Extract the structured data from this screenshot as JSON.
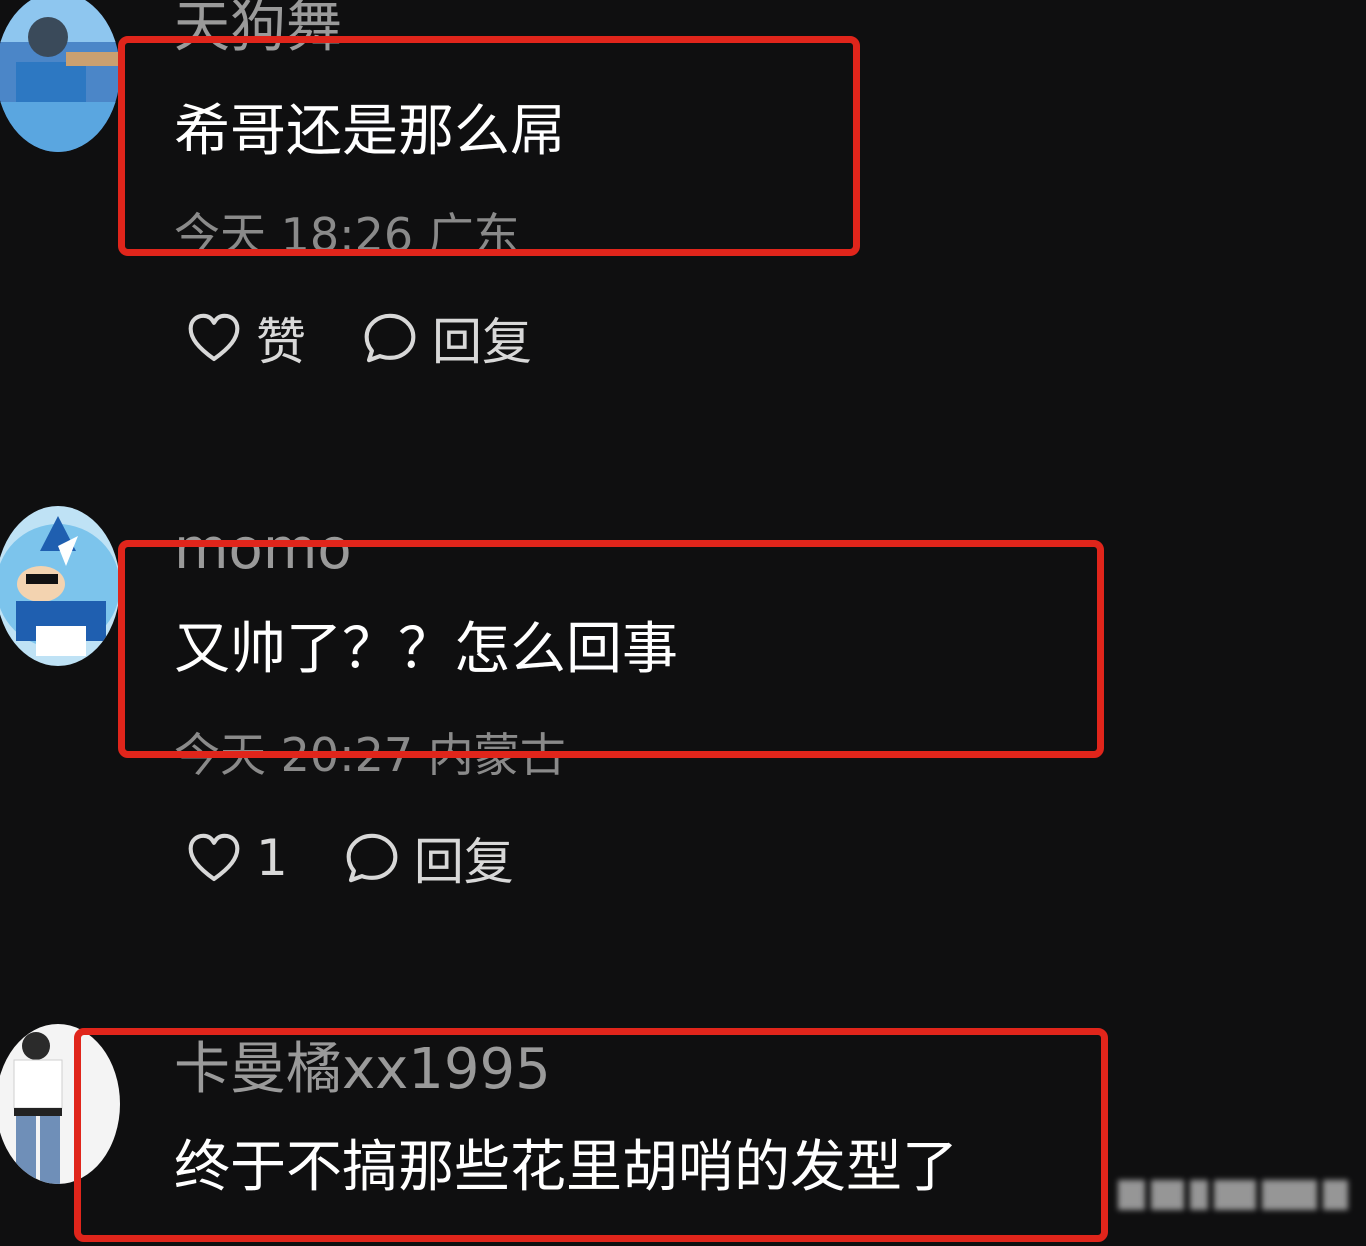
{
  "comments": [
    {
      "username": "天狗舞",
      "text": "希哥还是那么屌",
      "meta": "今天 18:26 广东",
      "likes_label": "赞",
      "reply_label": "回复"
    },
    {
      "username": "momo",
      "text": "又帅了？？怎么回事",
      "meta": "今天 20:27 内蒙古",
      "likes_label": "1",
      "reply_label": "回复"
    },
    {
      "username": "卡曼橘xx1995",
      "text": "终于不搞那些花里胡哨的发型了"
    }
  ],
  "icons": {
    "like": "heart-icon",
    "reply": "comment-bubble-icon"
  },
  "colors": {
    "background": "#0f0f10",
    "highlight": "#e0251b",
    "username": "#9a9a9a",
    "meta": "#8a8a8a"
  }
}
